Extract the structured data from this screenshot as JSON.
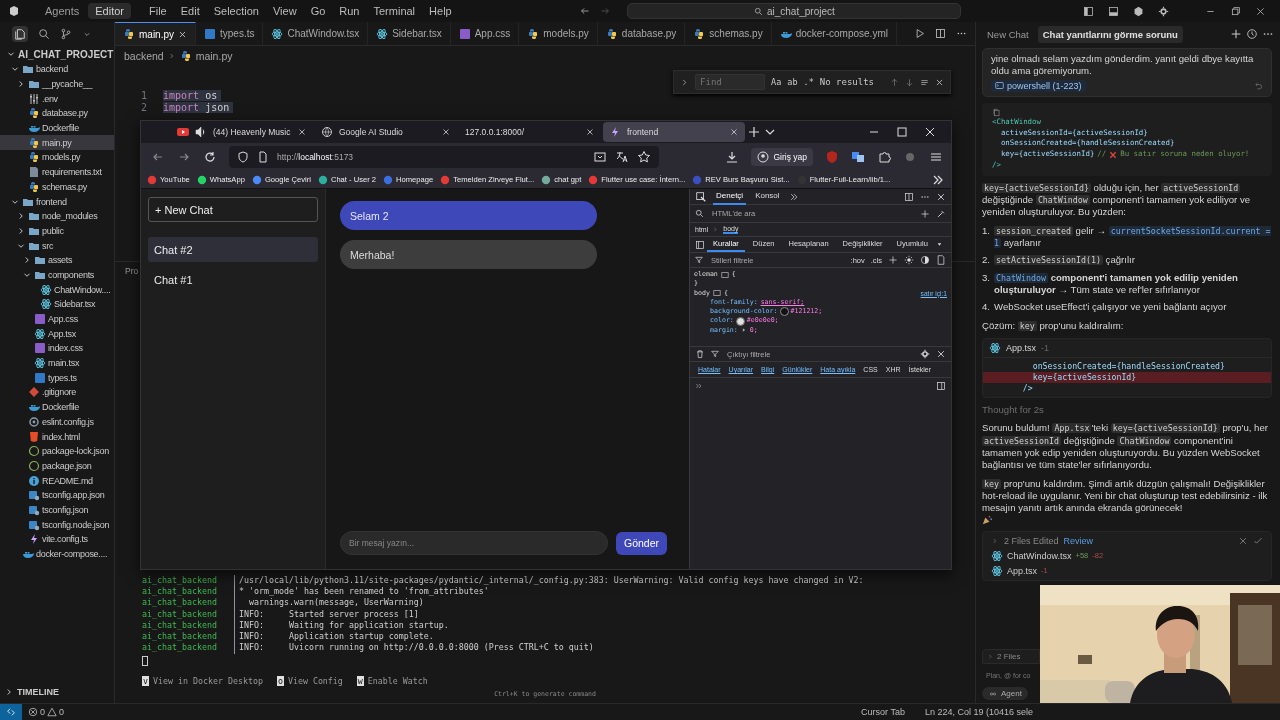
{
  "titlebar": {
    "modes": [
      {
        "label": "Agents",
        "selected": false
      },
      {
        "label": "Editor",
        "selected": true
      }
    ],
    "menu": [
      "File",
      "Edit",
      "Selection",
      "View",
      "Go",
      "Run",
      "Terminal",
      "Help"
    ],
    "search": "ai_chat_project"
  },
  "explorer": {
    "title": "AI_CHAT_PROJECT",
    "tree": [
      {
        "label": "backend",
        "kind": "folder",
        "expanded": true,
        "selected": false,
        "children": [
          {
            "label": "__pycache__",
            "kind": "folder",
            "expanded": false,
            "selected": false
          },
          {
            "label": ".env",
            "kind": "env",
            "selected": false
          },
          {
            "label": "database.py",
            "kind": "py",
            "selected": false
          },
          {
            "label": "Dockerfile",
            "kind": "docker",
            "selected": false
          },
          {
            "label": "main.py",
            "kind": "py",
            "selected": true
          },
          {
            "label": "models.py",
            "kind": "py",
            "selected": false
          },
          {
            "label": "requirements.txt",
            "kind": "txt",
            "selected": false
          },
          {
            "label": "schemas.py",
            "kind": "py",
            "selected": false
          }
        ]
      },
      {
        "label": "frontend",
        "kind": "folder",
        "expanded": true,
        "selected": false,
        "children": [
          {
            "label": "node_modules",
            "kind": "folder",
            "expanded": false,
            "selected": false
          },
          {
            "label": "public",
            "kind": "folder",
            "expanded": false,
            "selected": false
          },
          {
            "label": "src",
            "kind": "folder",
            "expanded": true,
            "selected": false,
            "children": [
              {
                "label": "assets",
                "kind": "folder",
                "expanded": false,
                "selected": false
              },
              {
                "label": "components",
                "kind": "folder",
                "expanded": true,
                "selected": false,
                "children": [
                  {
                    "label": "ChatWindow....",
                    "kind": "react",
                    "selected": false
                  },
                  {
                    "label": "Sidebar.tsx",
                    "kind": "react",
                    "selected": false
                  }
                ]
              },
              {
                "label": "App.css",
                "kind": "css",
                "selected": false
              },
              {
                "label": "App.tsx",
                "kind": "react",
                "selected": false
              },
              {
                "label": "index.css",
                "kind": "css",
                "selected": false
              },
              {
                "label": "main.tsx",
                "kind": "react",
                "selected": false
              },
              {
                "label": "types.ts",
                "kind": "ts",
                "selected": false
              }
            ]
          },
          {
            "label": ".gitignore",
            "kind": "git",
            "selected": false
          },
          {
            "label": "Dockerfile",
            "kind": "docker",
            "selected": false
          },
          {
            "label": "eslint.config.js",
            "kind": "js",
            "selected": false
          },
          {
            "label": "index.html",
            "kind": "html",
            "selected": false
          },
          {
            "label": "package-lock.json",
            "kind": "json",
            "selected": false
          },
          {
            "label": "package.json",
            "kind": "json",
            "selected": false
          },
          {
            "label": "README.md",
            "kind": "md",
            "selected": false
          },
          {
            "label": "tsconfig.app.json",
            "kind": "tsconfig",
            "selected": false
          },
          {
            "label": "tsconfig.json",
            "kind": "tsconfig",
            "selected": false
          },
          {
            "label": "tsconfig.node.json",
            "kind": "tsconfig",
            "selected": false
          },
          {
            "label": "vite.config.ts",
            "kind": "vite",
            "selected": false
          }
        ]
      },
      {
        "label": "docker-compose....",
        "kind": "docker",
        "selected": false
      }
    ],
    "timeline": "TIMELINE"
  },
  "editor": {
    "tabs": [
      {
        "label": "main.py",
        "kind": "py",
        "selected": true
      },
      {
        "label": "types.ts",
        "kind": "ts",
        "selected": false
      },
      {
        "label": "ChatWindow.tsx",
        "kind": "react",
        "selected": false
      },
      {
        "label": "Sidebar.tsx",
        "kind": "react",
        "selected": false
      },
      {
        "label": "App.css",
        "kind": "css",
        "selected": false
      },
      {
        "label": "models.py",
        "kind": "py",
        "selected": false
      },
      {
        "label": "database.py",
        "kind": "py",
        "selected": false
      },
      {
        "label": "schemas.py",
        "kind": "py",
        "selected": false
      },
      {
        "label": "docker-compose.yml",
        "kind": "docker",
        "selected": false
      }
    ],
    "breadcrumb": [
      "backend",
      "main.py"
    ],
    "find": {
      "placeholder": "Find",
      "toggles": [
        "Aa",
        "ab",
        ".*"
      ],
      "result": "No results"
    },
    "lines": [
      {
        "number": "1",
        "keyword": "import",
        "name": "os"
      },
      {
        "number": "2",
        "keyword": "import",
        "name": "json"
      }
    ],
    "panel_tab": "Pro",
    "terminal": [
      {
        "source": "ai_chat_backend",
        "text": "/usr/local/lib/python3.11/site-packages/pydantic/_internal/_config.py:383: UserWarning: Valid config keys have changed in V2:"
      },
      {
        "source": "ai_chat_backend",
        "text": "* 'orm_mode' has been renamed to 'from_attributes'"
      },
      {
        "source": "ai_chat_backend",
        "text": "  warnings.warn(message, UserWarning)"
      },
      {
        "source": "ai_chat_backend",
        "text": "INFO:     Started server process [1]"
      },
      {
        "source": "ai_chat_backend",
        "text": "INFO:     Waiting for application startup."
      },
      {
        "source": "ai_chat_backend",
        "text": "INFO:     Application startup complete."
      },
      {
        "source": "ai_chat_backend",
        "text": "INFO:     Uvicorn running on http://0.0.0.0:8000 (Press CTRL+C to quit)"
      }
    ],
    "docker_actions": [
      {
        "key": "v",
        "label": "View in Docker Desktop"
      },
      {
        "key": "o",
        "label": "View Config"
      },
      {
        "key": "w",
        "label": "Enable Watch"
      }
    ],
    "hint": "Ctrl+K to generate command"
  },
  "browser": {
    "tabs": [
      {
        "title": "(44) Heavenly Music",
        "kind": "media",
        "selected": false
      },
      {
        "title": "Google AI Studio",
        "kind": "site",
        "selected": false
      },
      {
        "title": "127.0.0.1:8000/",
        "kind": "blank",
        "selected": false
      },
      {
        "title": "frontend",
        "kind": "vite",
        "selected": true
      }
    ],
    "url_prefix": "http://",
    "url_host": "localhost",
    "url_port": ":5173",
    "sign_in": "Giriş yap",
    "bookmarks": [
      {
        "label": "YouTube",
        "color": "#e53935"
      },
      {
        "label": "WhatsApp",
        "color": "#25d366"
      },
      {
        "label": "Google Çeviri",
        "color": "#4a8af4"
      },
      {
        "label": "Chat - User 2",
        "color": "#2bb0a0"
      },
      {
        "label": "Homepage",
        "color": "#3b6fe0"
      },
      {
        "label": "Temelden Zirveye Flut...",
        "color": "#e53935"
      },
      {
        "label": "chat gpt",
        "color": "#74aa9c"
      },
      {
        "label": "Flutter use case: İntern...",
        "color": "#e53935"
      },
      {
        "label": "REV Burs Başvuru Sist...",
        "color": "#3a4fc0"
      },
      {
        "label": "Flutter-Full-Learn/lib/1...",
        "color": "#333333"
      }
    ],
    "app": {
      "new_chat": "+ New Chat",
      "chats": [
        {
          "label": "Chat #2",
          "selected": true
        },
        {
          "label": "Chat #1",
          "selected": false
        }
      ],
      "messages": [
        {
          "kind": "user",
          "text": "Selam 2"
        },
        {
          "kind": "assistant",
          "text": "Merhaba!"
        }
      ],
      "input_placeholder": "Bir mesaj yazın...",
      "send": "Gönder"
    },
    "devtools": {
      "tabs": [
        {
          "label": "Denetçi",
          "selected": true
        },
        {
          "label": "Konsol",
          "selected": false
        }
      ],
      "search_placeholder": "HTML'de ara",
      "path": [
        {
          "label": "html",
          "selected": false
        },
        {
          "label": "body",
          "selected": true
        }
      ],
      "rule_tabs": [
        {
          "label": "Kurallar",
          "selected": true
        },
        {
          "label": "Düzen",
          "selected": false
        },
        {
          "label": "Hesaplanan",
          "selected": false
        },
        {
          "label": "Değişiklikler",
          "selected": false
        },
        {
          "label": "Uyumlulu",
          "selected": false
        }
      ],
      "filter_placeholder": "Stilleri filtrele",
      "pseudo": [
        ":hov",
        ".cls"
      ],
      "rules": [
        {
          "selector": "eleman",
          "open": "{",
          "close": "}"
        },
        {
          "selector": "body",
          "open": "{",
          "source": "satır içi:1",
          "props": [
            {
              "name": "font-family:",
              "value": "sans-serif;",
              "kind": "link"
            },
            {
              "name": "background-color:",
              "value": "#121212;",
              "kind": "swatch",
              "color": "#121212"
            },
            {
              "name": "color:",
              "value": "#e0e0e0;",
              "kind": "swatch",
              "color": "#e0e0e0"
            },
            {
              "name": "margin:",
              "value": "0;",
              "kind": "expand"
            }
          ]
        }
      ],
      "console_placeholder": "Çıktıyı filtrele",
      "console_filters": [
        {
          "label": "Hatalar",
          "on": true
        },
        {
          "label": "Uyarılar",
          "on": true
        },
        {
          "label": "Bilgi",
          "on": true
        },
        {
          "label": "Günlükler",
          "on": true
        },
        {
          "label": "Hata ayıkla",
          "on": true
        },
        {
          "label": "CSS",
          "on": false
        },
        {
          "label": "XHR",
          "on": false
        },
        {
          "label": "İstekler",
          "on": false
        }
      ]
    }
  },
  "chat": {
    "tabs": [
      {
        "label": "New Chat",
        "selected": false
      },
      {
        "label": "Chat yanıtlarını görme sorunu",
        "selected": true
      }
    ],
    "user_message": "yine olmadı selam yazdım gönderdim. yanıt geldi dbye kayıtta oldu ama göremiyorum.",
    "attachment": "powershell (1-223)",
    "code": [
      {
        "text": "<ChatWindow",
        "kind": "tag"
      },
      {
        "text": "  activeSessionId={activeSessionId}",
        "kind": "attr"
      },
      {
        "text": "  onSessionCreated={handleSessionCreated}",
        "kind": "attr"
      },
      {
        "text": "  key={activeSessionId}",
        "kind": "attr",
        "comment": "//",
        "note": "Bu satır soruna neden oluyor!"
      },
      {
        "text": "/>",
        "kind": "tag"
      }
    ],
    "intro": [
      {
        "t": "key={activeSessionId}",
        "kind": "code"
      },
      {
        "t": " olduğu için, her "
      },
      {
        "t": "activeSessionId",
        "kind": "code"
      },
      {
        "t": " değiştiğinde "
      },
      {
        "t": "ChatWindow",
        "kind": "code"
      },
      {
        "t": " component'i tamamen yok ediliyor ve yeniden oluşturuluyor. Bu yüzden:"
      }
    ],
    "steps": [
      {
        "number": "1.",
        "parts": [
          {
            "t": "session_created",
            "kind": "code"
          },
          {
            "t": " gelir → "
          },
          {
            "t": "currentSocketSessionId.current = 1",
            "kind": "ref"
          },
          {
            "t": " ayarlanır"
          }
        ]
      },
      {
        "number": "2.",
        "parts": [
          {
            "t": "setActiveSessionId(1)",
            "kind": "code"
          },
          {
            "t": " çağrılır"
          }
        ]
      },
      {
        "number": "3.",
        "parts": [
          {
            "t": "ChatWindow",
            "kind": "ref"
          },
          {
            "t": " component'i tamamen yok edilip yeniden oluşturuluyor",
            "kind": "bold"
          },
          {
            "t": " → Tüm state ve ref'ler sıfırlanıyor"
          }
        ]
      },
      {
        "number": "4.",
        "parts": [
          {
            "t": "WebSocket useEffect'i çalışıyor ve yeni bağlantı açıyor"
          }
        ]
      }
    ],
    "solution": [
      {
        "t": "Çözüm: "
      },
      {
        "t": "key",
        "kind": "code"
      },
      {
        "t": " prop'unu kaldıralım:"
      }
    ],
    "diff": {
      "file": "App.tsx",
      "count": "-1",
      "lines": [
        {
          "text": "    onSessionCreated={handleSessionCreated}",
          "kind": "context"
        },
        {
          "text": "    key={activeSessionId}",
          "kind": "removed"
        },
        {
          "text": "  />",
          "kind": "context"
        }
      ]
    },
    "thought": "Thought for 2s",
    "answer": [
      [
        {
          "t": "Sorunu buldum! "
        },
        {
          "t": "App.tsx",
          "kind": "code"
        },
        {
          "t": "'teki "
        },
        {
          "t": "key={activeSessionId}",
          "kind": "code"
        },
        {
          "t": " prop'u, her "
        },
        {
          "t": "activeSessionId",
          "kind": "code"
        },
        {
          "t": " değiştiğinde "
        },
        {
          "t": "ChatWindow",
          "kind": "code"
        },
        {
          "t": " component'ini tamamen yok edip yeniden oluşturuyordu. Bu yüzden WebSocket bağlantısı ve tüm state'ler sıfırlanıyordu."
        }
      ],
      [
        {
          "t": "key",
          "kind": "code"
        },
        {
          "t": " prop'unu kaldırdım. Şimdi artık düzgün çalışmalı! Değişiklikler hot-reload ile uygulanır. Yeni bir chat oluşturup test edebilirsiniz - ilk mesajın yanıtı artık anında ekranda görünecek!"
        }
      ]
    ],
    "edited": {
      "title": "2 Files Edited",
      "review": "Review",
      "files": [
        {
          "name": "ChatWindow.tsx",
          "added": "+58",
          "removed": "-82"
        },
        {
          "name": "App.tsx",
          "removed": "-1"
        }
      ]
    },
    "files_bar": "2 Files",
    "composer_placeholder": "Plan, @ for co",
    "mode": "Agent"
  },
  "status": {
    "errors": "0",
    "warnings": "0",
    "items": [
      "Cursor Tab",
      "Ln 224, Col 19 (10416 sele"
    ]
  }
}
